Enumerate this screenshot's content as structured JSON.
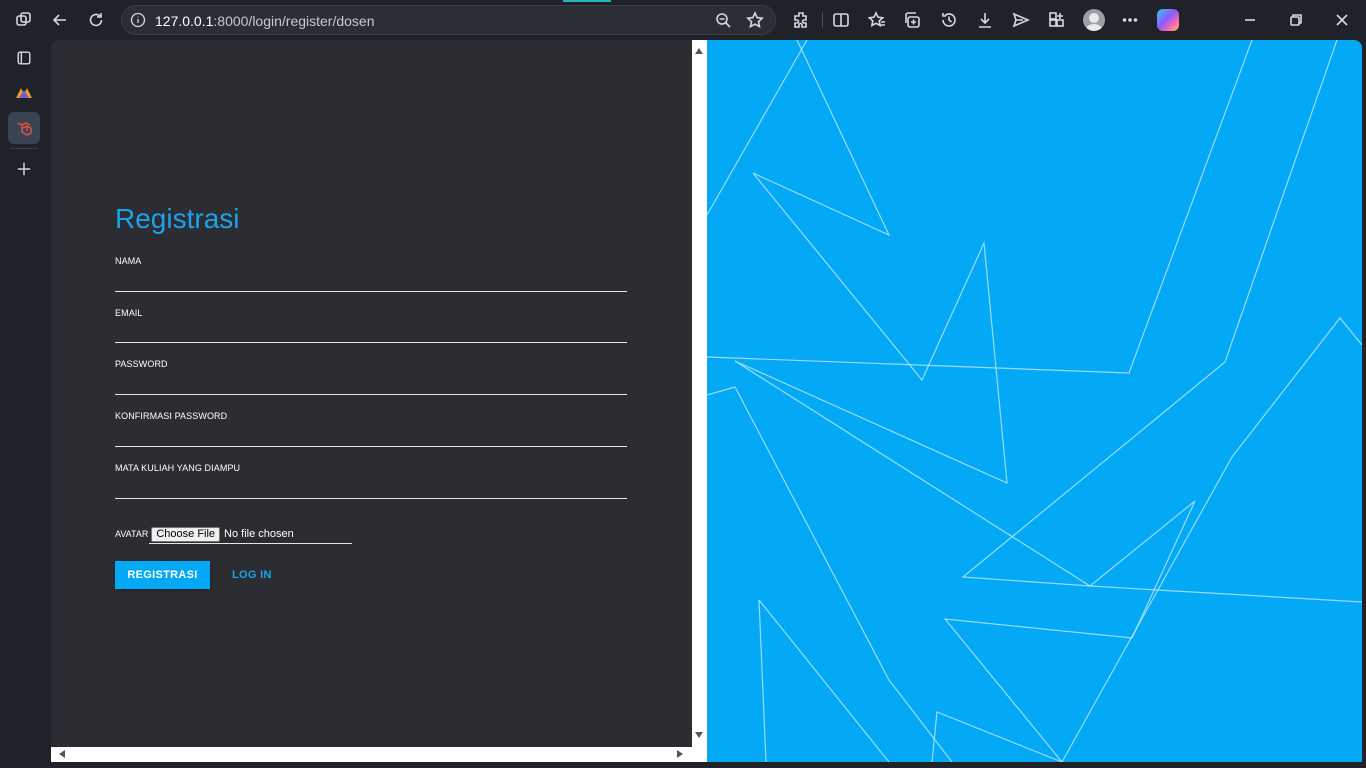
{
  "browser": {
    "url_host": "127.0.0.1",
    "url_rest": ":8000/login/register/dosen"
  },
  "form": {
    "title": "Registrasi",
    "fields": [
      {
        "label": "NAMA"
      },
      {
        "label": "EMAIL"
      },
      {
        "label": "PASSWORD"
      },
      {
        "label": "KONFIRMASI PASSWORD"
      },
      {
        "label": "MATA KULIAH YANG DIAMPU"
      }
    ],
    "avatar_label": "AVATAR",
    "file_button": "Choose File",
    "file_status": "No file chosen",
    "register_button": "REGISTRASI",
    "login_link": "LOG IN"
  },
  "colors": {
    "accent": "#03a9f4",
    "title": "#1aa3ea",
    "panel": "#2b2d33"
  }
}
